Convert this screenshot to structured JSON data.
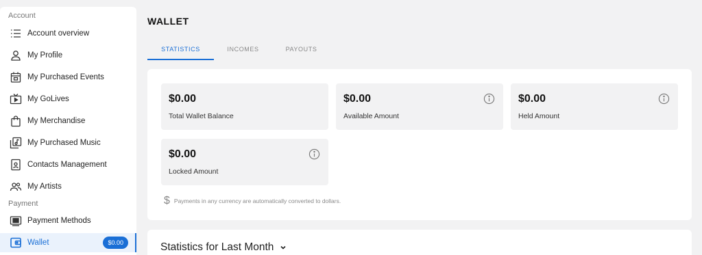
{
  "sidebar": {
    "account_label": "Account",
    "payment_label": "Payment",
    "items": [
      {
        "label": "Account overview",
        "icon": "list-icon"
      },
      {
        "label": "My Profile",
        "icon": "person-icon"
      },
      {
        "label": "My Purchased Events",
        "icon": "calendar-icon"
      },
      {
        "label": "My GoLives",
        "icon": "tv-play-icon"
      },
      {
        "label": "My Merchandise",
        "icon": "shopping-bag-icon"
      },
      {
        "label": "My Purchased Music",
        "icon": "music-library-icon"
      },
      {
        "label": "Contacts Management",
        "icon": "contact-card-icon"
      },
      {
        "label": "My Artists",
        "icon": "people-icon"
      },
      {
        "label": "Payment Methods",
        "icon": "payment-card-icon"
      },
      {
        "label": "Wallet",
        "icon": "wallet-icon",
        "badge": "$0.00",
        "active": true
      }
    ]
  },
  "page": {
    "title": "WALLET",
    "tabs": [
      {
        "label": "STATISTICS",
        "active": true
      },
      {
        "label": "INCOMES",
        "active": false
      },
      {
        "label": "PAYOUTS",
        "active": false
      }
    ]
  },
  "cards": [
    {
      "amount": "$0.00",
      "caption": "Total Wallet Balance",
      "info": false
    },
    {
      "amount": "$0.00",
      "caption": "Available Amount",
      "info": true
    },
    {
      "amount": "$0.00",
      "caption": "Held Amount",
      "info": true
    },
    {
      "amount": "$0.00",
      "caption": "Locked Amount",
      "info": true
    }
  ],
  "note": {
    "symbol": "$",
    "text": "Payments in any currency are automatically converted to dollars."
  },
  "stats": {
    "title": "Statistics for Last Month"
  },
  "colors": {
    "accent": "#1a6fd6",
    "background": "#f2f2f3",
    "card": "#f2f2f3"
  }
}
